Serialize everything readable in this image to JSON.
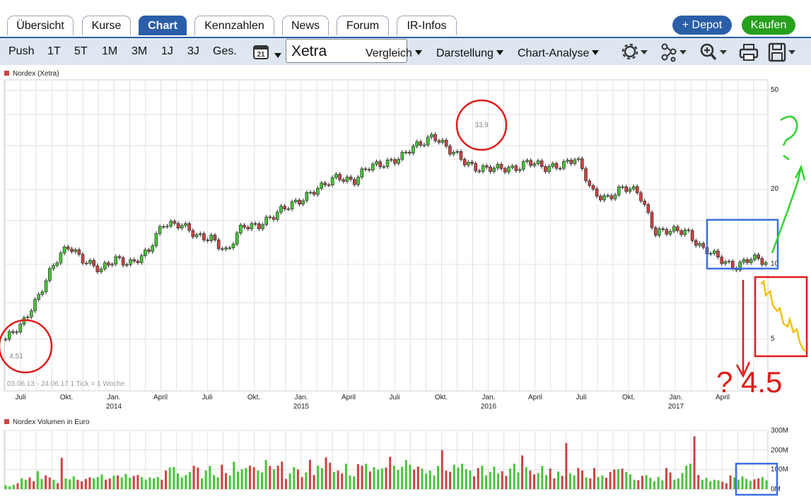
{
  "tabs": [
    {
      "label": "Übersicht",
      "active": false
    },
    {
      "label": "Kurse",
      "active": false
    },
    {
      "label": "Chart",
      "active": true
    },
    {
      "label": "Kennzahlen",
      "active": false
    },
    {
      "label": "News",
      "active": false
    },
    {
      "label": "Forum",
      "active": false
    },
    {
      "label": "IR-Infos",
      "active": false
    }
  ],
  "actions": {
    "depot": "+ Depot",
    "kaufen": "Kaufen",
    "depot_color": "#2a5fa8",
    "kaufen_color": "#27a01d"
  },
  "toolbar": {
    "periods": [
      "Push",
      "1T",
      "5T",
      "1M",
      "3M",
      "1J",
      "3J",
      "Ges."
    ],
    "calendar_day": "21",
    "exchange": "Xetra",
    "compare": "Vergleich",
    "display": "Darstellung",
    "analysis": "Chart-Analyse",
    "icons": [
      "settings-icon",
      "network-icon",
      "zoom-icon",
      "print-icon",
      "save-icon"
    ]
  },
  "price_chart": {
    "legend": "Nordex (Xetra)",
    "range_note": "03.06.13 - 24.06.17    1 Tick = 1 Woche",
    "high_label": "33,9",
    "low_label": "4,51",
    "y_ticks": [
      "50",
      "20",
      "10",
      "5"
    ]
  },
  "x_axis": {
    "months": [
      "Juli",
      "Okt.",
      "Jan.",
      "April",
      "Juli",
      "Okt.",
      "Jan.",
      "April",
      "Juli",
      "Okt.",
      "Jan.",
      "April",
      "Juli",
      "Okt.",
      "Jan.",
      "April"
    ],
    "years": [
      "2014",
      "2015",
      "2016",
      "2017"
    ]
  },
  "volume_chart": {
    "legend": "Nordex Volumen in Euro",
    "y_ticks": [
      "300M",
      "200M",
      "100M",
      "0M"
    ]
  },
  "annotations": {
    "question": "?",
    "target": "? 4.5"
  },
  "colors": {
    "up": "#49c43a",
    "down": "#c94444",
    "grid": "#e1e1e1",
    "accent": "#2a5fa8"
  },
  "chart_data": [
    {
      "type": "candlestick",
      "title": "Nordex (Xetra)",
      "x_range": [
        "2013-06-03",
        "2017-06-24"
      ],
      "y_scale": "log",
      "y_ticks": [
        5,
        10,
        20,
        50
      ],
      "series": [
        {
          "name": "Nordex (Xetra)",
          "x": [
            "2013-06",
            "2013-07",
            "2013-08",
            "2013-09",
            "2013-10",
            "2013-11",
            "2013-12",
            "2014-01",
            "2014-02",
            "2014-03",
            "2014-04",
            "2014-05",
            "2014-06",
            "2014-07",
            "2014-08",
            "2014-09",
            "2014-10",
            "2014-11",
            "2014-12",
            "2015-01",
            "2015-02",
            "2015-03",
            "2015-04",
            "2015-05",
            "2015-06",
            "2015-07",
            "2015-08",
            "2015-09",
            "2015-10",
            "2015-11",
            "2015-12",
            "2016-01",
            "2016-02",
            "2016-03",
            "2016-04",
            "2016-05",
            "2016-06",
            "2016-07",
            "2016-08",
            "2016-09",
            "2016-10",
            "2016-11",
            "2016-12",
            "2017-01",
            "2017-02",
            "2017-03",
            "2017-04",
            "2017-05",
            "2017-06"
          ],
          "close": [
            5.0,
            5.6,
            7.4,
            9.8,
            11.8,
            10.5,
            9.3,
            10.6,
            10.2,
            11.0,
            14.9,
            14.5,
            12.8,
            13.0,
            11.0,
            14.3,
            14.6,
            15.5,
            17.5,
            19.0,
            20.2,
            23.0,
            21.5,
            24.5,
            26.0,
            26.8,
            30.0,
            33.5,
            28.3,
            26.0,
            24.3,
            23.9,
            24.5,
            25.9,
            24.0,
            25.5,
            26.5,
            19.5,
            18.7,
            20.0,
            19.5,
            13.5,
            13.4,
            13.8,
            11.5,
            10.5,
            9.9,
            10.5,
            10.1
          ]
        }
      ],
      "annotations": {
        "high": 33.9,
        "low": 4.51
      }
    },
    {
      "type": "bar",
      "title": "Nordex Volumen in Euro",
      "unit": "M",
      "y_ticks": [
        0,
        100,
        200,
        300
      ],
      "values": [
        20,
        15,
        22,
        30,
        55,
        48,
        60,
        40,
        92,
        52,
        70,
        60,
        48,
        30,
        160,
        55,
        50,
        65,
        48,
        40,
        52,
        60,
        55,
        62,
        75,
        48,
        55,
        68,
        70,
        60,
        78,
        58,
        68,
        72,
        62,
        48,
        60,
        55,
        62,
        48,
        95,
        110,
        112,
        80,
        60,
        72,
        88,
        120,
        110,
        55,
        95,
        118,
        72,
        60,
        125,
        82,
        70,
        140,
        90,
        102,
        108,
        120,
        112,
        95,
        85,
        148,
        118,
        102,
        120,
        140,
        52,
        80,
        112,
        100,
        62,
        85,
        150,
        72,
        120,
        108,
        162,
        135,
        88,
        95,
        80,
        130,
        70,
        65,
        128,
        120,
        130,
        90,
        112,
        100,
        105,
        110,
        165,
        120,
        98,
        115,
        148,
        125,
        100,
        115,
        105,
        80,
        95,
        70,
        118,
        200,
        95,
        88,
        125,
        110,
        130,
        102,
        95,
        65,
        108,
        120,
        70,
        88,
        115,
        80,
        92,
        68,
        105,
        130,
        85,
        172,
        112,
        95,
        75,
        82,
        118,
        72,
        105,
        55,
        90,
        68,
        235,
        80,
        70,
        108,
        95,
        60,
        55,
        108,
        62,
        70,
        58,
        88,
        100,
        102,
        105,
        88,
        75,
        48,
        45,
        68,
        72,
        58,
        40,
        62,
        45,
        108,
        85,
        48,
        55,
        82,
        120,
        130,
        270,
        72,
        48,
        58,
        40,
        48,
        45,
        38,
        30,
        70,
        60,
        48,
        65,
        52,
        42,
        50,
        55,
        62,
        45
      ]
    }
  ]
}
